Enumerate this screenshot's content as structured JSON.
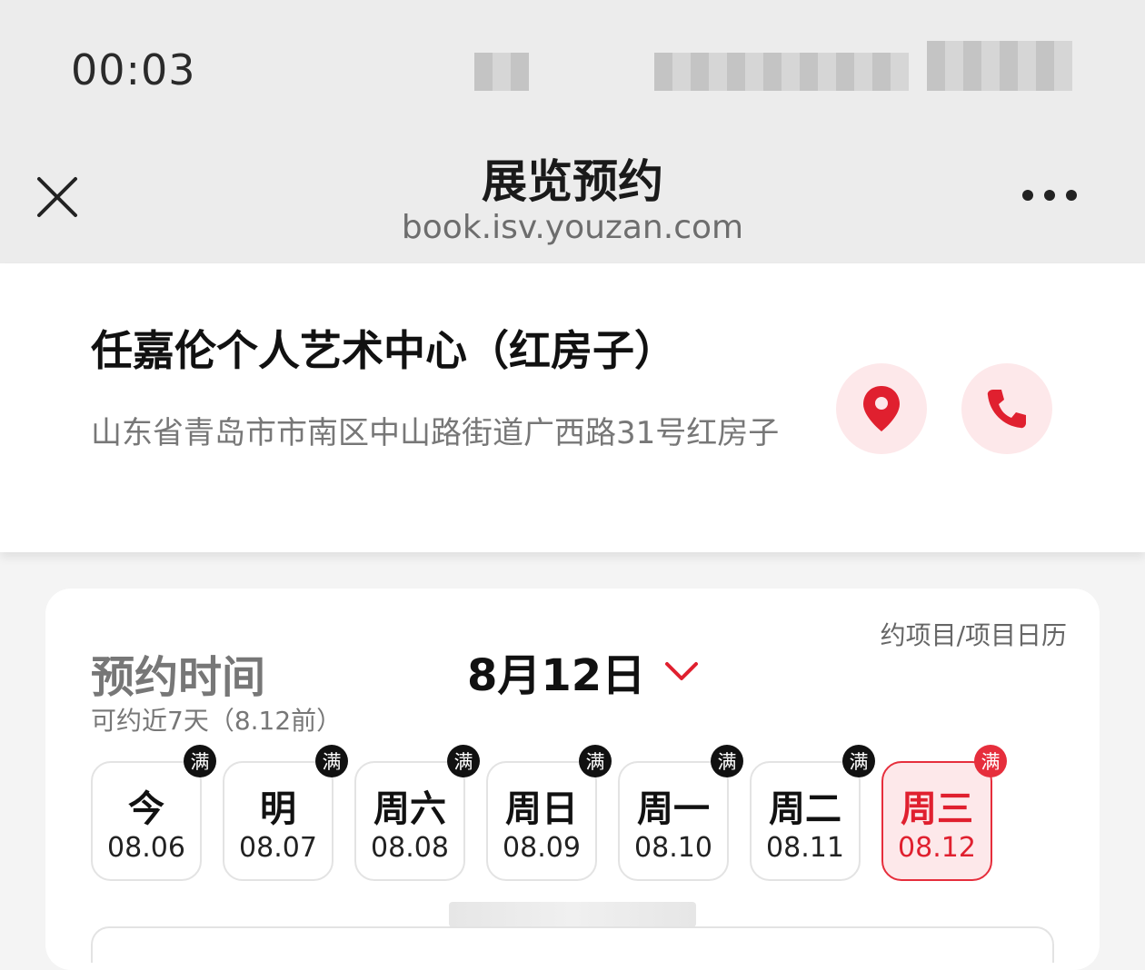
{
  "status_bar": {
    "time": "00:03"
  },
  "nav": {
    "title": "展览预约",
    "url": "book.isv.youzan.com",
    "close_icon": "close-icon",
    "more_icon": "more-dots-icon"
  },
  "venue": {
    "name": "任嘉伦个人艺术中心（红房子）",
    "address": "山东省青岛市市南区中山路街道广西路31号红房子",
    "location_icon": "location-pin-icon",
    "phone_icon": "phone-icon"
  },
  "booking": {
    "calendar_link": "约项目/项目日历",
    "section_title": "预约时间",
    "selected_date": "8月12日",
    "range_note": "可约近7天（8.12前）",
    "days": [
      {
        "label": "今",
        "date": "08.06",
        "badge": "满"
      },
      {
        "label": "明",
        "date": "08.07",
        "badge": "满"
      },
      {
        "label": "周六",
        "date": "08.08",
        "badge": "满"
      },
      {
        "label": "周日",
        "date": "08.09",
        "badge": "满"
      },
      {
        "label": "周一",
        "date": "08.10",
        "badge": "满"
      },
      {
        "label": "周二",
        "date": "08.11",
        "badge": "满"
      },
      {
        "label": "周三",
        "date": "08.12",
        "badge": "满"
      }
    ],
    "selected_index": 6
  },
  "colors": {
    "accent": "#e62e3c",
    "accent_light": "#fde8ea",
    "nav_bg": "#ececec"
  }
}
